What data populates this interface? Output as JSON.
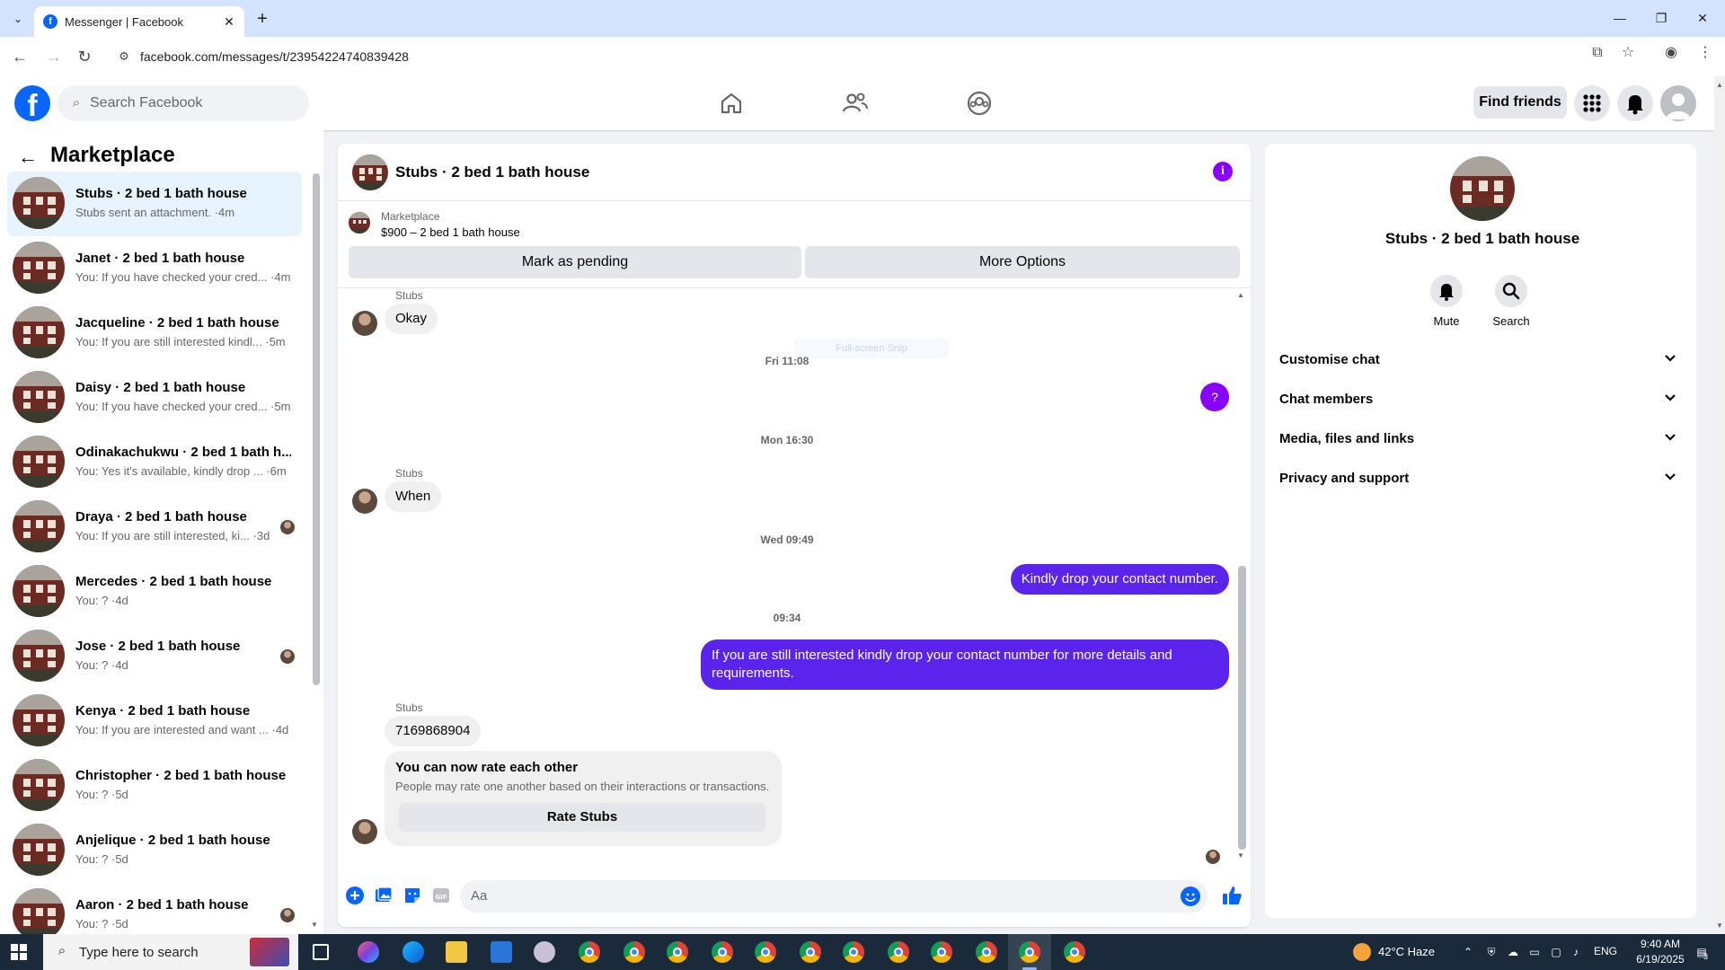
{
  "browser": {
    "tab_title": "Messenger | Facebook",
    "url": "facebook.com/messages/t/23954224740839428",
    "window_controls": [
      "minimize",
      "restore",
      "close"
    ]
  },
  "fb_nav": {
    "search_placeholder": "Search Facebook",
    "find_friends": "Find friends",
    "icons": [
      "home-icon",
      "friends-icon",
      "groups-icon",
      "menu-grid-icon",
      "notifications-icon",
      "account-icon"
    ]
  },
  "sidebar": {
    "title": "Marketplace",
    "conversations": [
      {
        "name": "Stubs · 2 bed 1 bath house",
        "preview": "Stubs sent an attachment. ·4m",
        "active": true,
        "seen": false
      },
      {
        "name": "Janet · 2 bed 1 bath house",
        "preview": "You: If you have checked your cred... ·4m",
        "active": false,
        "seen": false
      },
      {
        "name": "Jacqueline · 2 bed 1 bath house",
        "preview": "You: If you are still interested kindl... ·5m",
        "active": false,
        "seen": false
      },
      {
        "name": "Daisy · 2 bed 1 bath house",
        "preview": "You: If you have checked your cred... ·5m",
        "active": false,
        "seen": false
      },
      {
        "name": "Odinakachukwu · 2 bed 1 bath h...",
        "preview": "You: Yes it's available, kindly drop ... ·6m",
        "active": false,
        "seen": false
      },
      {
        "name": "Draya · 2 bed 1 bath house",
        "preview": "You: If you are still interested, ki... ·3d",
        "active": false,
        "seen": true
      },
      {
        "name": "Mercedes · 2 bed 1 bath house",
        "preview": "You: ? ·4d",
        "active": false,
        "seen": false
      },
      {
        "name": "Jose · 2 bed 1 bath house",
        "preview": "You: ? ·4d",
        "active": false,
        "seen": true
      },
      {
        "name": "Kenya · 2 bed 1 bath house",
        "preview": "You: If you are interested and want ... ·4d",
        "active": false,
        "seen": false
      },
      {
        "name": "Christopher · 2 bed 1 bath house",
        "preview": "You: ? ·5d",
        "active": false,
        "seen": false
      },
      {
        "name": "Anjelique · 2 bed 1 bath house",
        "preview": "You: ? ·5d",
        "active": false,
        "seen": false
      },
      {
        "name": "Aaron · 2 bed 1 bath house",
        "preview": "You: ? ·5d",
        "active": false,
        "seen": true
      }
    ]
  },
  "chat": {
    "title": "Stubs · 2 bed 1 bath house",
    "marketplace_label": "Marketplace",
    "listing": "$900 – 2 bed 1 bath house",
    "mark_pending": "Mark as pending",
    "more_options": "More Options",
    "messages": {
      "sender_1": "Stubs",
      "okay": "Okay",
      "ts_fri": "Fri 11:08",
      "snip_hint": "Full-screen Snip",
      "question": "?",
      "ts_mon": "Mon 16:30",
      "sender_2": "Stubs",
      "when": "When",
      "ts_wed": "Wed 09:49",
      "out_1": "Kindly drop your contact number.",
      "ts_0934": "09:34",
      "out_2": "If you are still interested kindly drop your contact number for more details and requirements.",
      "sender_3": "Stubs",
      "phone": "7169868904",
      "rate_title": "You can now rate each other",
      "rate_sub": "People may rate one another based on their interactions or transactions.",
      "rate_btn": "Rate Stubs"
    },
    "composer_placeholder": "Aa"
  },
  "right_panel": {
    "name": "Stubs · 2 bed 1 bath house",
    "mute": "Mute",
    "search": "Search",
    "sections": [
      "Customise chat",
      "Chat members",
      "Media, files and links",
      "Privacy and support"
    ]
  },
  "taskbar": {
    "search_placeholder": "Type here to search",
    "weather": "42°C Haze",
    "lang": "ENG",
    "time": "9:40 AM",
    "date": "6/19/2025",
    "notif_count": "3"
  },
  "colors": {
    "accent": "#5b24ec",
    "info": "#8a00ff",
    "fb_blue": "#0866ff"
  }
}
